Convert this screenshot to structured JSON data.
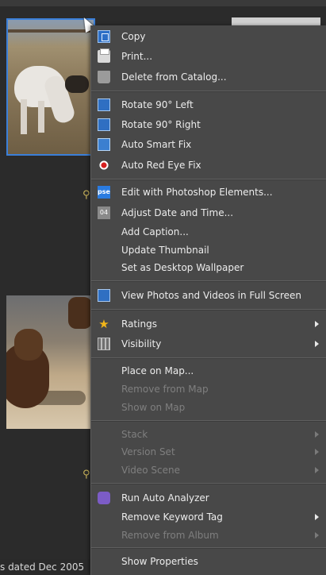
{
  "status_text": "s dated Dec 2005",
  "menu": {
    "items": [
      {
        "label": "Copy",
        "icon": "copy-icon"
      },
      {
        "label": "Print...",
        "icon": "print-icon"
      },
      {
        "label": "Delete from Catalog...",
        "icon": "trash-icon"
      },
      {
        "label": "Rotate 90° Left",
        "icon": "rotate-left-icon"
      },
      {
        "label": "Rotate 90° Right",
        "icon": "rotate-right-icon"
      },
      {
        "label": "Auto Smart Fix",
        "icon": "auto-smart-fix-icon"
      },
      {
        "label": "Auto Red Eye Fix",
        "icon": "red-eye-icon"
      },
      {
        "label": "Edit with Photoshop Elements...",
        "icon": "pse-icon",
        "icon_text": "pse"
      },
      {
        "label": "Adjust Date and Time...",
        "icon": "calendar-icon",
        "icon_text": "04"
      },
      {
        "label": "Add Caption..."
      },
      {
        "label": "Update Thumbnail"
      },
      {
        "label": "Set as Desktop Wallpaper"
      },
      {
        "label": "View Photos and Videos in Full Screen",
        "icon": "full-screen-icon"
      },
      {
        "label": "Ratings",
        "icon": "star-icon"
      },
      {
        "label": "Visibility",
        "icon": "visibility-icon"
      },
      {
        "label": "Place on Map..."
      },
      {
        "label": "Remove from Map"
      },
      {
        "label": "Show on Map"
      },
      {
        "label": "Stack"
      },
      {
        "label": "Version Set"
      },
      {
        "label": "Video Scene"
      },
      {
        "label": "Run Auto Analyzer",
        "icon": "auto-analyzer-icon"
      },
      {
        "label": "Remove Keyword Tag"
      },
      {
        "label": "Remove from Album"
      },
      {
        "label": "Show Properties"
      }
    ]
  }
}
